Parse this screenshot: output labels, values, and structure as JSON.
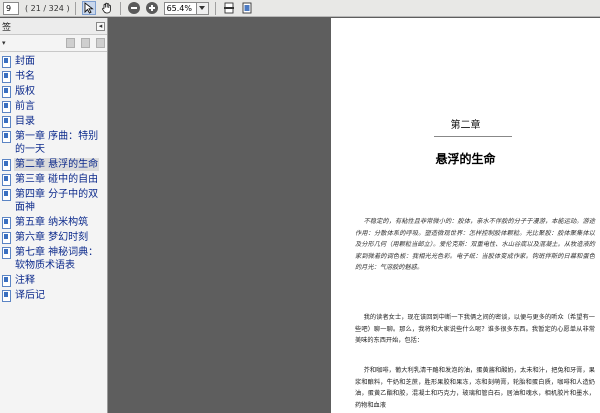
{
  "toolbar": {
    "page_number": "9",
    "page_position": "( 21 / 324 )",
    "zoom": "65.4%"
  },
  "sidebar": {
    "title": "签",
    "options_label": "▾",
    "items": [
      {
        "label": "封面"
      },
      {
        "label": "书名"
      },
      {
        "label": "版权"
      },
      {
        "label": "前言"
      },
      {
        "label": "目录"
      },
      {
        "label": "第一章 序曲：特别的一天"
      },
      {
        "label": "第二章 悬浮的生命"
      },
      {
        "label": "第三章 碰中的自由"
      },
      {
        "label": "第四章 分子中的双面神"
      },
      {
        "label": "第五章 纳米构筑"
      },
      {
        "label": "第六章 梦幻时刻"
      },
      {
        "label": "第七章 神秘词典：软物质术语表"
      },
      {
        "label": "注释"
      },
      {
        "label": "译后记"
      }
    ]
  },
  "page": {
    "chapter_number": "第二章",
    "chapter_title": "悬浮的生命",
    "epigraph": "不稳定的，有粘性且非常微小的：胶体，亲水不伴胶的分子于漫游，本能运动。游途作用：分散体系的呼吸。塑造微观世界：怎样控制胶体颗粒。光比聚胶：胶体聚集体以及分形几何（用颗粒当邮立）。爱伦克斯：双重电性、水山谷底以及混凝土。从牧造液的家到微着的调色板：我相光光色彩。电子纸：当胶体变成作家。钩斑拌斯的日幕和蛋色的月光：气溶胶的魅惑。",
    "para2": "我的读者女士，现在该回到中断一下我俩之间的密谈，以便与更多的听众（希望有一些吧）聊一聊。那么，我将和大家说些什么呢？谁多很多东西。我暂定的心愿单从非常美味的东西开始，包括：",
    "para3": "芥和咖啡，葡大利乳清干酪和发泡的油，蛋黄酱和酸奶，太未和汁，把兔和牙膏，果浆和酿料，牛奶和芝蔗，胜形果胶和果冻，冻和刻萌膏，轮胎和蛋白质，咖啡和人造奶油，蛋黄乙酯和胶，混凝土和巧克力，玻璃和管白石，居油和魂水，相机胶片和墨水，药物和血液"
  }
}
